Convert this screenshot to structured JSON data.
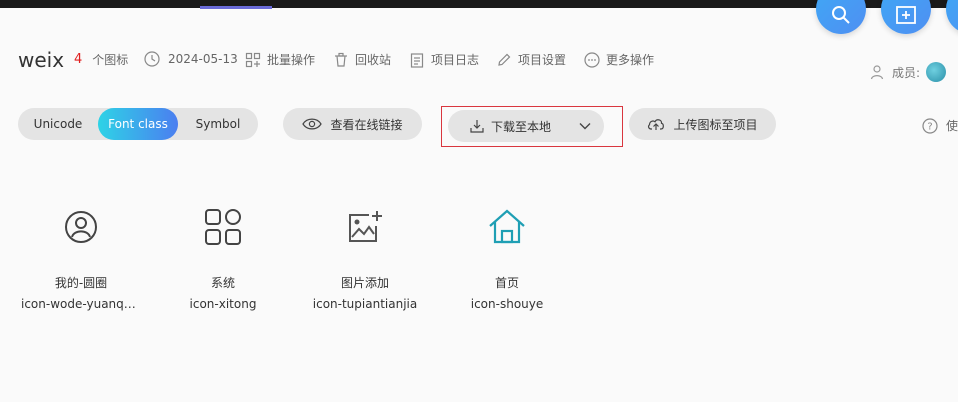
{
  "project": {
    "title": "weix",
    "icon_count": "4",
    "icon_count_unit": "个图标",
    "date": "2024-05-13",
    "actions": [
      "批量操作",
      "回收站",
      "项目日志",
      "项目设置",
      "更多操作"
    ]
  },
  "members": {
    "label": "成员:"
  },
  "tabs": {
    "items": [
      "Unicode",
      "Font class",
      "Symbol"
    ],
    "active": "Font class"
  },
  "toolbar": {
    "view_link": "查看在线链接",
    "download": "下载至本地",
    "upload": "上传图标至项目",
    "help": "使"
  },
  "icons": [
    {
      "name": "我的-圆圈",
      "code": "icon-wode-yuanquan",
      "icon": "user-circle-icon"
    },
    {
      "name": "系统",
      "code": "icon-xitong",
      "icon": "grid-system-icon"
    },
    {
      "name": "图片添加",
      "code": "icon-tupiantianjia",
      "icon": "image-add-icon"
    },
    {
      "name": "首页",
      "code": "icon-shouye",
      "icon": "home-icon"
    }
  ],
  "colors": {
    "accent_gradient_start": "#2ed3e6",
    "accent_gradient_end": "#4b7ef0",
    "count_red": "#e02020",
    "home_icon": "#1f9fb4",
    "highlight_border": "#d9363e"
  }
}
